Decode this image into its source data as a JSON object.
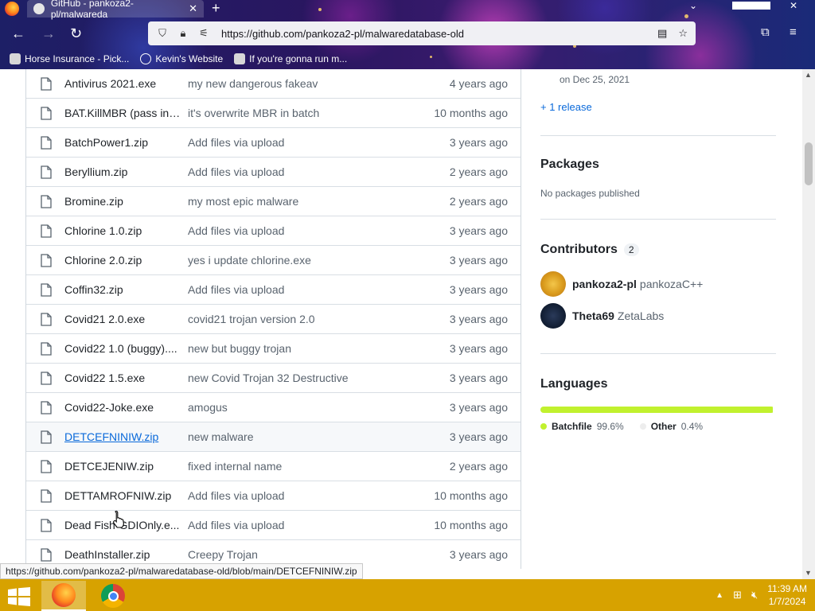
{
  "browser": {
    "tab_title": "GitHub - pankoza2-pl/malwareda",
    "url": "https://github.com/pankoza2-pl/malwaredatabase-old",
    "bookmarks": [
      {
        "icon": "horse-icon",
        "label": "Horse Insurance - Pick..."
      },
      {
        "icon": "globe-icon",
        "label": "Kevin's Website"
      },
      {
        "icon": "skull-icon",
        "label": "If you're gonna run m..."
      }
    ],
    "status_url": "https://github.com/pankoza2-pl/malwaredatabase-old/blob/main/DETCEFNINIW.zip"
  },
  "files": [
    {
      "name": "Antivirus 2021.exe",
      "message": "my new dangerous fakeav",
      "age": "4 years ago"
    },
    {
      "name": "BAT.KillMBR (pass inf...",
      "message": "it's overwrite MBR in batch",
      "age": "10 months ago"
    },
    {
      "name": "BatchPower1.zip",
      "message": "Add files via upload",
      "age": "3 years ago"
    },
    {
      "name": "Beryllium.zip",
      "message": "Add files via upload",
      "age": "2 years ago"
    },
    {
      "name": "Bromine.zip",
      "message": "my most epic malware",
      "age": "2 years ago"
    },
    {
      "name": "Chlorine 1.0.zip",
      "message": "Add files via upload",
      "age": "3 years ago"
    },
    {
      "name": "Chlorine 2.0.zip",
      "message": "yes i update chlorine.exe",
      "age": "3 years ago"
    },
    {
      "name": "Coffin32.zip",
      "message": "Add files via upload",
      "age": "3 years ago"
    },
    {
      "name": "Covid21 2.0.exe",
      "message": "covid21 trojan version 2.0",
      "age": "3 years ago"
    },
    {
      "name": "Covid22 1.0 (buggy)....",
      "message": "new but buggy trojan",
      "age": "3 years ago"
    },
    {
      "name": "Covid22 1.5.exe",
      "message": "new Covid Trojan 32 Destructive",
      "age": "3 years ago"
    },
    {
      "name": "Covid22-Joke.exe",
      "message": "amogus",
      "age": "3 years ago"
    },
    {
      "name": "DETCEFNINIW.zip",
      "message": "new malware",
      "age": "3 years ago",
      "hovered": true
    },
    {
      "name": "DETCEJENIW.zip",
      "message": "fixed internal name",
      "age": "2 years ago"
    },
    {
      "name": "DETTAMROFNIW.zip",
      "message": "Add files via upload",
      "age": "10 months ago"
    },
    {
      "name": "Dead Fish-GDIOnly.e...",
      "message": "Add files via upload",
      "age": "10 months ago"
    },
    {
      "name": "DeathInstaller.zip",
      "message": "Creepy Trojan",
      "age": "3 years ago"
    }
  ],
  "sidebar": {
    "release_date": "on Dec 25, 2021",
    "more_releases": "+ 1 release",
    "packages_title": "Packages",
    "packages_empty": "No packages published",
    "contributors_title": "Contributors",
    "contributors_count": "2",
    "contributors": [
      {
        "login": "pankoza2-pl",
        "name": "pankozaC++"
      },
      {
        "login": "Theta69",
        "name": "ZetaLabs"
      }
    ],
    "languages_title": "Languages",
    "languages": [
      {
        "name": "Batchfile",
        "percent": "99.6%",
        "value": 99.6,
        "color": "#C1F12E"
      },
      {
        "name": "Other",
        "percent": "0.4%",
        "value": 0.4,
        "color": "#EDEDED"
      }
    ]
  },
  "taskbar": {
    "time": "11:39 AM",
    "date": "1/7/2024"
  },
  "colors": {
    "link": "#0969da",
    "muted": "#59636e",
    "taskbar": "#d7a200"
  }
}
